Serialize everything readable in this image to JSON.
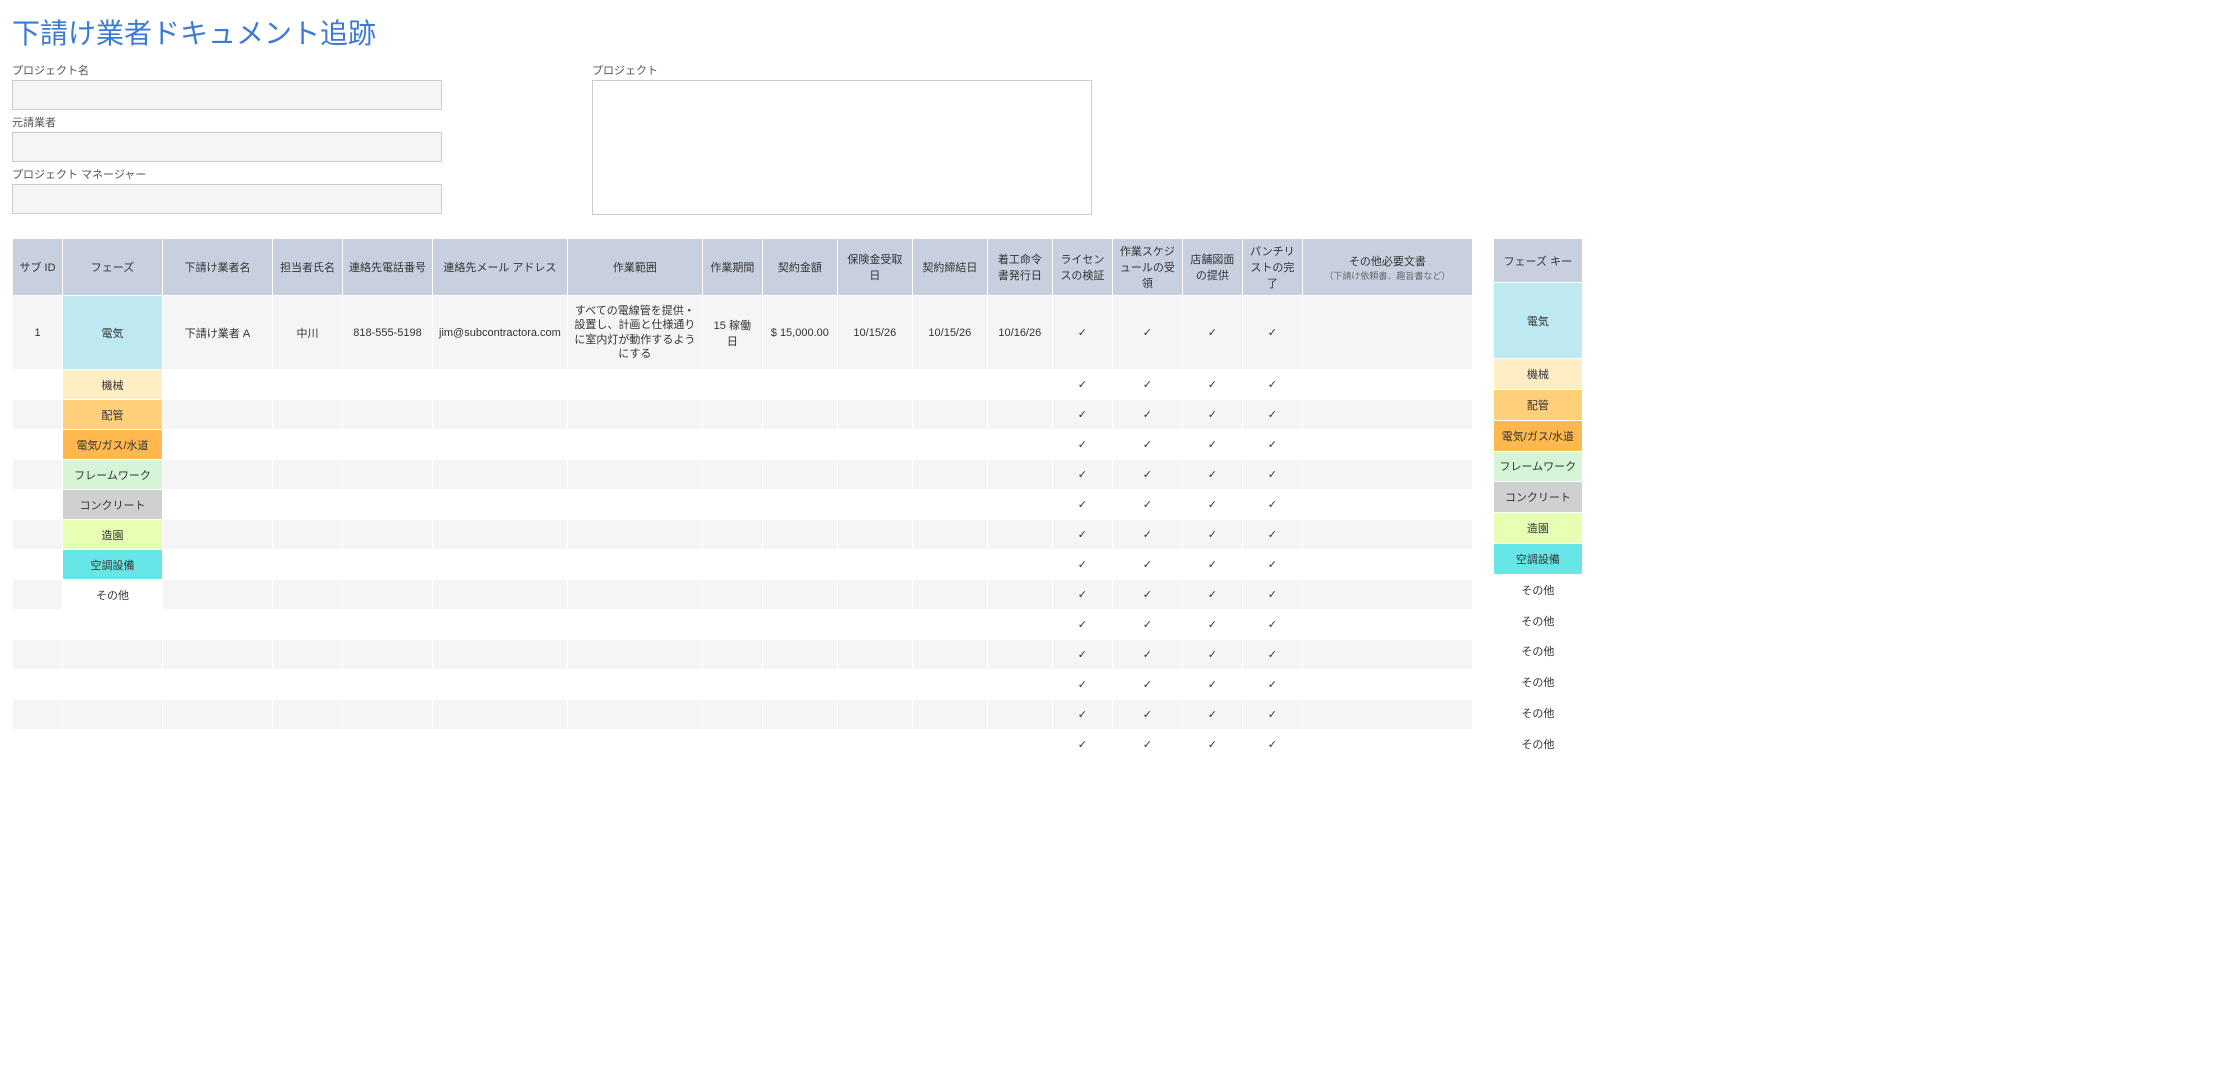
{
  "title": "下請け業者ドキュメント追跡",
  "form": {
    "projectName": {
      "label": "プロジェクト名",
      "value": ""
    },
    "primeContractor": {
      "label": "元請業者",
      "value": ""
    },
    "projectManager": {
      "label": "プロジェクト マネージャー",
      "value": ""
    },
    "project": {
      "label": "プロジェクト",
      "value": ""
    }
  },
  "columns": {
    "subId": "サブ ID",
    "phase": "フェーズ",
    "subName": "下請け業者名",
    "contactName": "担当者氏名",
    "contactPhone": "連絡先電話番号",
    "contactEmail": "連絡先メール アドレス",
    "scope": "作業範囲",
    "duration": "作業期間",
    "amount": "契約金額",
    "insuranceDate": "保険金受取日",
    "contractDate": "契約締結日",
    "proceedDate": "着工命令書発行日",
    "license": "ライセンスの検証",
    "schedule": "作業スケジュールの受領",
    "shopDrawings": "店舗図面の提供",
    "punchList": "パンチリストの完了",
    "otherDocs": "その他必要文書",
    "otherDocsSub": "（下請け依頼書、趣旨書など）"
  },
  "phaseKeyHeader": "フェーズ キー",
  "phaseKey": [
    {
      "label": "電気",
      "color": "#bceaf0"
    },
    {
      "label": "機械",
      "color": "#ffedc4"
    },
    {
      "label": "配管",
      "color": "#ffcf7a"
    },
    {
      "label": "電気/ガス/水道",
      "color": "#ffb84d"
    },
    {
      "label": "フレームワーク",
      "color": "#d6f5d6"
    },
    {
      "label": "コンクリート",
      "color": "#d0d0d0"
    },
    {
      "label": "造園",
      "color": "#e6ffb3"
    },
    {
      "label": "空調設備",
      "color": "#66e6e6"
    },
    {
      "label": "その他",
      "color": "#ffffff"
    },
    {
      "label": "その他",
      "color": "#ffffff"
    },
    {
      "label": "その他",
      "color": "#ffffff"
    },
    {
      "label": "その他",
      "color": "#ffffff"
    },
    {
      "label": "その他",
      "color": "#ffffff"
    },
    {
      "label": "その他",
      "color": "#ffffff"
    }
  ],
  "rows": [
    {
      "subId": "1",
      "phase": "電気",
      "phaseColor": "#bceaf0",
      "subName": "下請け業者 A",
      "contactName": "中川",
      "contactPhone": "818-555-5198",
      "contactEmail": "jim@subcontractora.com",
      "scope": "すべての電線管を提供・設置し、計画と仕様通りに室内灯が動作するようにする",
      "duration": "15 稼働日",
      "amount": "$   15,000.00",
      "insuranceDate": "10/15/26",
      "contractDate": "10/15/26",
      "proceedDate": "10/16/26",
      "license": "✓",
      "schedule": "✓",
      "shopDrawings": "✓",
      "punchList": "✓",
      "otherDocs": "",
      "tall": true
    },
    {
      "phase": "機械",
      "phaseColor": "#ffedc4",
      "license": "✓",
      "schedule": "✓",
      "shopDrawings": "✓",
      "punchList": "✓"
    },
    {
      "phase": "配管",
      "phaseColor": "#ffcf7a",
      "license": "✓",
      "schedule": "✓",
      "shopDrawings": "✓",
      "punchList": "✓"
    },
    {
      "phase": "電気/ガス/水道",
      "phaseColor": "#ffb84d",
      "license": "✓",
      "schedule": "✓",
      "shopDrawings": "✓",
      "punchList": "✓"
    },
    {
      "phase": "フレームワーク",
      "phaseColor": "#d6f5d6",
      "license": "✓",
      "schedule": "✓",
      "shopDrawings": "✓",
      "punchList": "✓"
    },
    {
      "phase": "コンクリート",
      "phaseColor": "#d0d0d0",
      "license": "✓",
      "schedule": "✓",
      "shopDrawings": "✓",
      "punchList": "✓"
    },
    {
      "phase": "造園",
      "phaseColor": "#e6ffb3",
      "license": "✓",
      "schedule": "✓",
      "shopDrawings": "✓",
      "punchList": "✓"
    },
    {
      "phase": "空調設備",
      "phaseColor": "#66e6e6",
      "license": "✓",
      "schedule": "✓",
      "shopDrawings": "✓",
      "punchList": "✓"
    },
    {
      "phase": "その他",
      "phaseColor": "#ffffff",
      "license": "✓",
      "schedule": "✓",
      "shopDrawings": "✓",
      "punchList": "✓"
    },
    {
      "phase": "",
      "phaseColor": null,
      "license": "✓",
      "schedule": "✓",
      "shopDrawings": "✓",
      "punchList": "✓"
    },
    {
      "phase": "",
      "phaseColor": null,
      "license": "✓",
      "schedule": "✓",
      "shopDrawings": "✓",
      "punchList": "✓"
    },
    {
      "phase": "",
      "phaseColor": null,
      "license": "✓",
      "schedule": "✓",
      "shopDrawings": "✓",
      "punchList": "✓"
    },
    {
      "phase": "",
      "phaseColor": null,
      "license": "✓",
      "schedule": "✓",
      "shopDrawings": "✓",
      "punchList": "✓"
    },
    {
      "phase": "",
      "phaseColor": null,
      "license": "✓",
      "schedule": "✓",
      "shopDrawings": "✓",
      "punchList": "✓"
    }
  ],
  "colWidths": {
    "subId": 50,
    "phase": 100,
    "subName": 110,
    "contactName": 70,
    "contactPhone": 90,
    "contactEmail": 130,
    "scope": 135,
    "duration": 60,
    "amount": 75,
    "insuranceDate": 75,
    "contractDate": 75,
    "proceedDate": 65,
    "license": 60,
    "schedule": 70,
    "shopDrawings": 60,
    "punchList": 60,
    "otherDocs": 170
  }
}
